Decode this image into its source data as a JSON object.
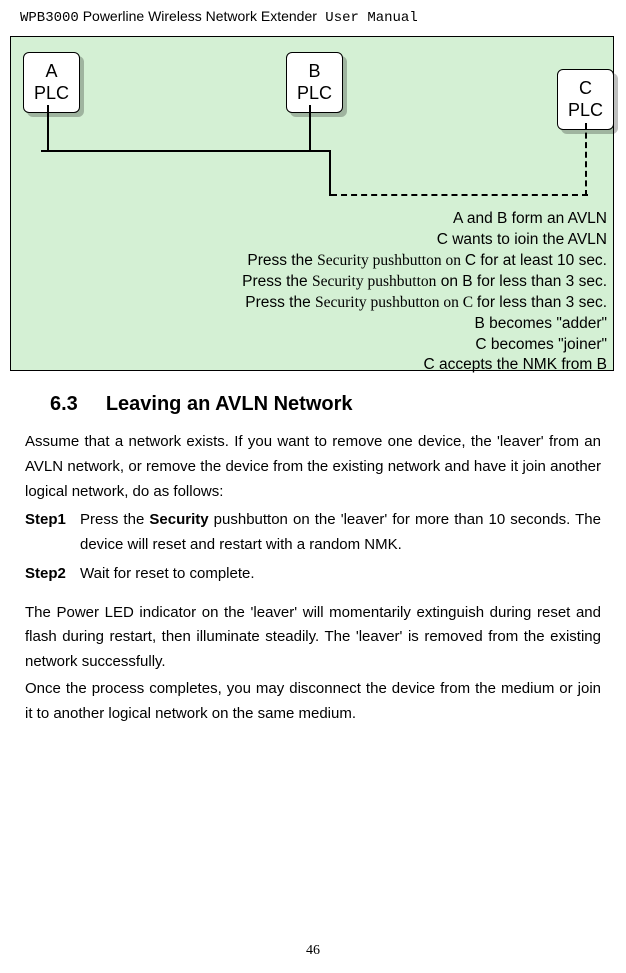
{
  "header": {
    "product": "WPB3000",
    "rest": " Powerline Wireless Network Extender",
    "tail": " User Manual"
  },
  "plc": {
    "a1": "A",
    "a2": "PLC",
    "b1": "B",
    "b2": "PLC",
    "c1": "C",
    "c2": "PLC"
  },
  "diagram_lines": {
    "l1": "A and B form an AVLN",
    "l2": "C wants to ioin the AVLN",
    "l3a": "Press the ",
    "l3b": "Security pushbutton on ",
    "l3c": "C for at least 10 sec.",
    "l4a": "Press the ",
    "l4b": "Security pushbutton",
    "l4c": " on B",
    "l4d": "for less than 3 sec.",
    "l5a": "Press the ",
    "l5b": "Security pushbutton on C ",
    "l5c": "for less than 3 sec.",
    "l6": "B becomes \"adder\"",
    "l7": "C becomes \"joiner\"",
    "l8": "C accepts the NMK from B"
  },
  "section": {
    "number": "6.3",
    "title": "Leaving an AVLN Network"
  },
  "para1": "Assume that a network exists. If you want to remove one device, the 'leaver' from an AVLN network, or remove the device from the existing network and have it join another logical network, do as follows:",
  "step1": {
    "label": "Step1",
    "body_a": "Press the ",
    "body_b": "Security",
    "body_c": " pushbutton on the 'leaver' for more than 10 seconds. The device will reset and restart with a random NMK."
  },
  "step2": {
    "label": "Step2",
    "body": "Wait for reset to complete."
  },
  "para2": "The Power LED indicator on the 'leaver' will momentarily extinguish during reset and flash during restart, then illuminate steadily. The 'leaver' is removed from the existing network successfully.",
  "para3": "Once the process completes, you may disconnect the device from the medium or join it to another logical network on the same medium.",
  "page_number": "46"
}
